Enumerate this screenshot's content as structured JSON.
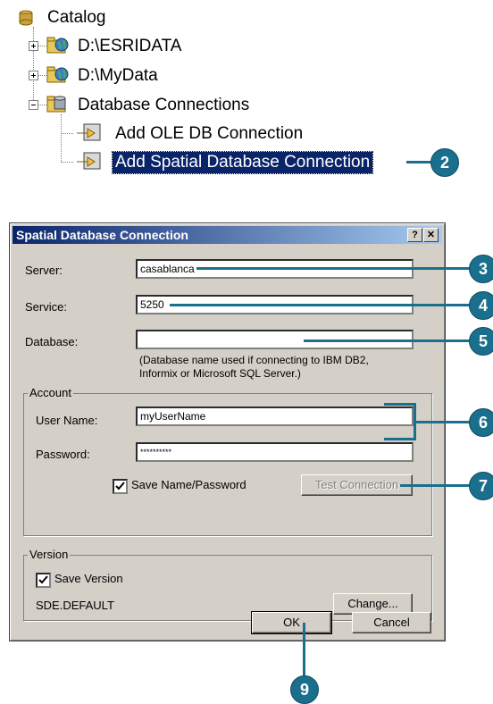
{
  "tree": {
    "items": [
      {
        "label": "Catalog"
      },
      {
        "label": "D:\\ESRIDATA"
      },
      {
        "label": "D:\\MyData"
      },
      {
        "label": "Database Connections"
      },
      {
        "label": "Add OLE DB Connection"
      },
      {
        "label": "Add Spatial Database Connection"
      }
    ]
  },
  "dialog": {
    "title": "Spatial Database Connection",
    "help_button": "?",
    "close_button": "✕",
    "server": {
      "label": "Server:",
      "value": "casablanca"
    },
    "service": {
      "label": "Service:",
      "value": "5250"
    },
    "database": {
      "label": "Database:",
      "value": "",
      "note": "(Database name used if connecting to IBM DB2, Informix or Microsoft SQL Server.)"
    },
    "account": {
      "legend": "Account",
      "username": {
        "label": "User Name:",
        "value": "myUserName"
      },
      "password": {
        "label": "Password:",
        "value": "**********"
      },
      "save_name_password": {
        "label": "Save Name/Password",
        "checked": true
      },
      "test_connection": "Test Connection"
    },
    "version": {
      "legend": "Version",
      "save_version": {
        "label": "Save Version",
        "checked": true
      },
      "current": "SDE.DEFAULT",
      "change": "Change..."
    },
    "ok": "OK",
    "cancel": "Cancel"
  },
  "callouts": [
    "2",
    "3",
    "4",
    "5",
    "6",
    "7",
    "9"
  ],
  "colors": {
    "callout": "#1a6f8c",
    "selection": "#0a246a",
    "dialog_bg": "#d4d0c8"
  }
}
